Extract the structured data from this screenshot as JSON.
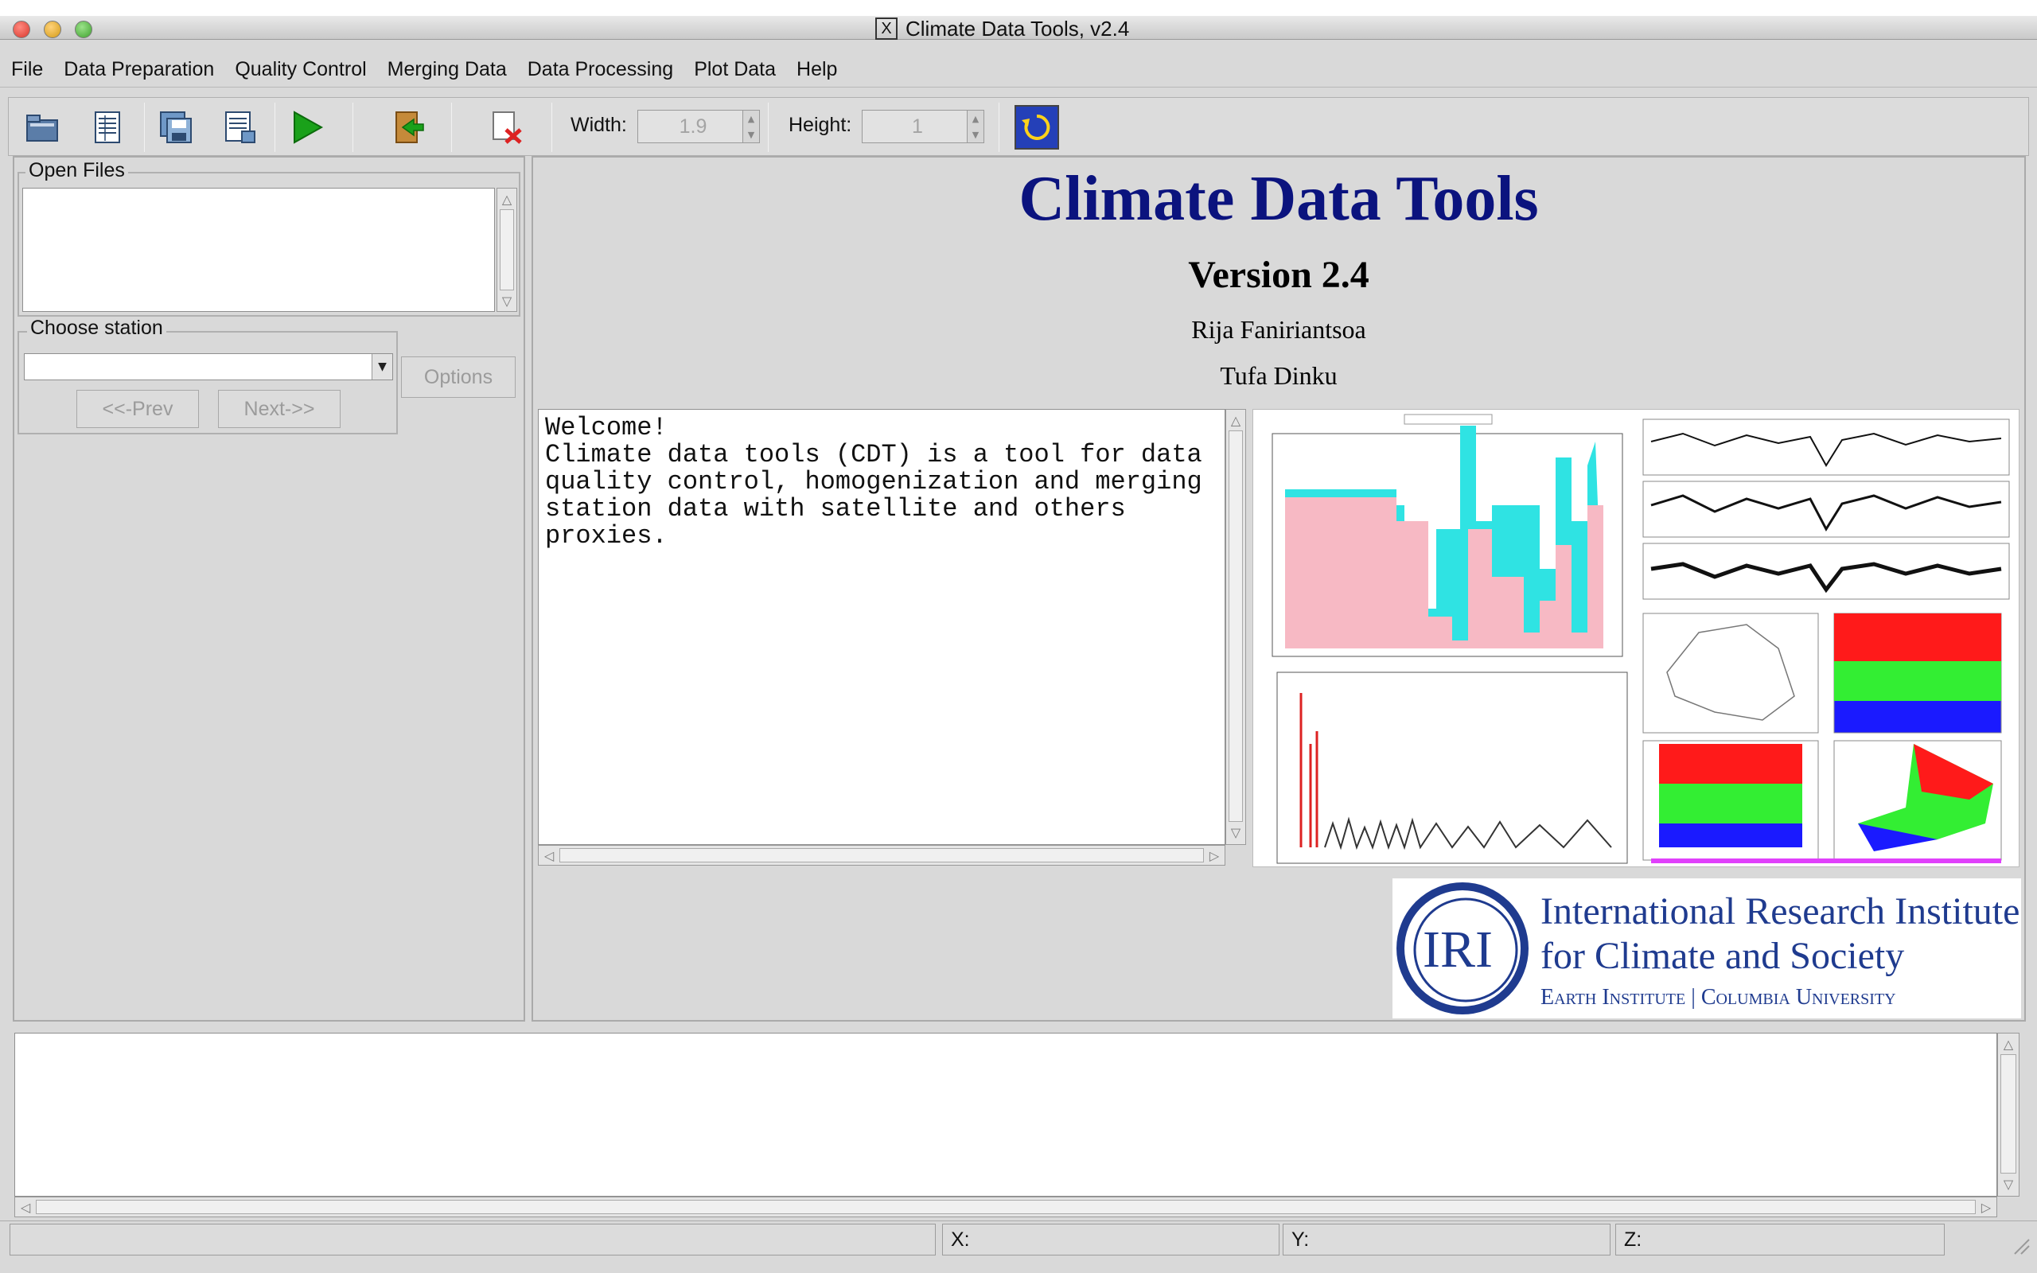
{
  "window": {
    "title": "Climate Data Tools, v2.4"
  },
  "menu": [
    {
      "label": "File"
    },
    {
      "label": "Data Preparation"
    },
    {
      "label": "Quality Control"
    },
    {
      "label": "Merging Data"
    },
    {
      "label": "Data Processing"
    },
    {
      "label": "Plot Data"
    },
    {
      "label": "Help"
    }
  ],
  "toolbar": {
    "width_label": "Width:",
    "width_value": "1.9",
    "height_label": "Height:",
    "height_value": "1",
    "icons": [
      "open-folder-icon",
      "open-table-icon",
      "save-icon",
      "save-table-icon",
      "run-icon",
      "exit-icon",
      "close-file-icon",
      "refresh-icon"
    ]
  },
  "left": {
    "open_files_label": "Open Files",
    "choose_station_label": "Choose station",
    "station_value": "",
    "options_label": "Options",
    "prev_label": "<<-Prev",
    "next_label": "Next->>"
  },
  "header": {
    "title": "Climate Data Tools",
    "version": "Version 2.4",
    "author1": "Rija Faniriantsoa",
    "author2": "Tufa Dinku"
  },
  "welcome_text": "Welcome!\nClimate data tools (CDT) is a tool for data\nquality control, homogenization and merging\nstation data with satellite and others\nproxies.",
  "logo": {
    "mark": "IRI",
    "line1": "International Research Institute",
    "line2": "for Climate and Society",
    "line3": "Earth Institute | Columbia University"
  },
  "status": {
    "x_label": "X:",
    "y_label": "Y:",
    "z_label": "Z:"
  },
  "colors": {
    "title_blue": "#0b137e",
    "logo_blue": "#1f3b8f",
    "run_green": "#1aa11a",
    "refresh_blue": "#1e36a8"
  }
}
